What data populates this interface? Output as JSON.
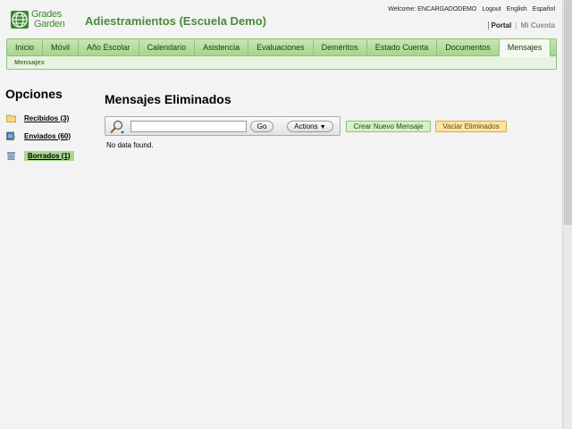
{
  "logo": {
    "line1": "Grades",
    "line2": "Garden"
  },
  "school_title": "Adiestramientos (Escuela Demo)",
  "top_links": {
    "welcome": "Welcome: ENCARGADODEMO",
    "logout": "Logout",
    "english": "English",
    "espanol": "Español"
  },
  "portal_links": {
    "portal": "Portal",
    "mi_cuenta": "Mi Cuenta"
  },
  "tabs": [
    "Inicio",
    "Móvil",
    "Año Escolar",
    "Calendario",
    "Asistencia",
    "Evaluaciones",
    "Deméritos",
    "Estado Cuenta",
    "Documentos",
    "Mensajes"
  ],
  "active_tab": "Mensajes",
  "subnav": "Mensajes",
  "options": {
    "title": "Opciones",
    "items": [
      {
        "label": "Recibidos (3)",
        "icon": "folder-icon"
      },
      {
        "label": "Enviados (60)",
        "icon": "sent-icon"
      },
      {
        "label": "Borrados (1)",
        "icon": "trash-icon"
      }
    ]
  },
  "main": {
    "title": "Mensajes Eliminados",
    "search_value": "",
    "go_label": "Go",
    "actions_label": "Actions",
    "new_message_label": "Crear Nuevo Mensaje",
    "empty_trash_label": "Vaciar Eliminados",
    "no_data": "No data found."
  },
  "colors": {
    "brand_green": "#4a8a3a",
    "tab_bg": "#b8dd9f",
    "empty_btn": "#fbe3a6"
  }
}
